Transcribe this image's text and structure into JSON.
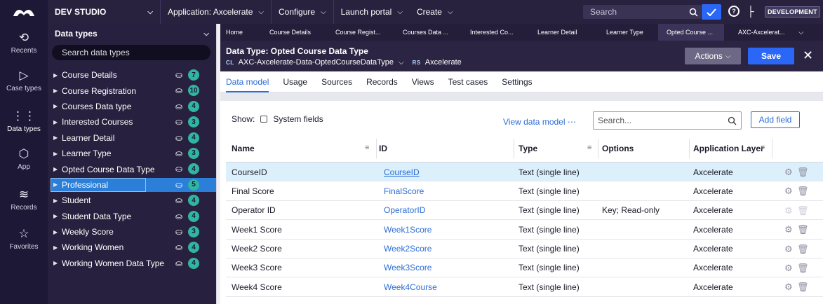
{
  "topbar": {
    "studio": "DEV STUDIO",
    "application": "Application: Axcelerate",
    "configure": "Configure",
    "launch": "Launch portal",
    "create": "Create",
    "search_placeholder": "Search",
    "dev_badge": "DEVELOPMENT"
  },
  "rail": [
    {
      "label": "Recents",
      "icon": "history-icon"
    },
    {
      "label": "Case types",
      "icon": "case-types-icon"
    },
    {
      "label": "Data types",
      "icon": "data-types-icon"
    },
    {
      "label": "App",
      "icon": "app-icon"
    },
    {
      "label": "Records",
      "icon": "records-icon"
    },
    {
      "label": "Favorites",
      "icon": "star-icon"
    }
  ],
  "panel": {
    "title": "Data types",
    "search_placeholder": "Search data types",
    "items": [
      {
        "name": "Course Details",
        "count": "7"
      },
      {
        "name": "Course Registration",
        "count": "10"
      },
      {
        "name": "Courses Data type",
        "count": "4"
      },
      {
        "name": "Interested Courses",
        "count": "3"
      },
      {
        "name": "Learner Detail",
        "count": "4"
      },
      {
        "name": "Learner Type",
        "count": "3"
      },
      {
        "name": "Opted Course Data Type",
        "count": "4"
      },
      {
        "name": "Professional",
        "count": "5"
      },
      {
        "name": "Student",
        "count": "4"
      },
      {
        "name": "Student Data Type",
        "count": "4"
      },
      {
        "name": "Weekly Score",
        "count": "3"
      },
      {
        "name": "Working Women",
        "count": "4"
      },
      {
        "name": "Working Women Data Type",
        "count": "4"
      }
    ]
  },
  "doc_tabs": [
    "Home",
    "Course Details",
    "Course Regist...",
    "Courses Data ...",
    "Interested Co...",
    "Learner Detail",
    "Learner Type",
    "Opted Course ...",
    "AXC-Axcelerat..."
  ],
  "header": {
    "title": "Data Type:  Opted Course Data Type",
    "cl_tag": "CL",
    "class_name": "AXC-Axcelerate-Data-OptedCourseDataType",
    "rs_tag": "RS",
    "ruleset": "Axcelerate",
    "actions": "Actions",
    "save": "Save"
  },
  "inner_tabs": [
    "Data model",
    "Usage",
    "Sources",
    "Records",
    "Views",
    "Test cases",
    "Settings"
  ],
  "toolbar": {
    "show_label": "Show:",
    "system_fields": "System fields",
    "view_data_model": "View data model",
    "search_placeholder": "Search...",
    "add_field": "Add field"
  },
  "table": {
    "columns": [
      "Name",
      "ID",
      "Type",
      "Options",
      "Application Layer"
    ],
    "rows": [
      {
        "name": "CourseID",
        "id": "CourseID",
        "type": "Text (single line)",
        "options": "",
        "layer": "Axcelerate"
      },
      {
        "name": "Final Score",
        "id": "FinalScore",
        "type": "Text (single line)",
        "options": "",
        "layer": "Axcelerate"
      },
      {
        "name": "Operator ID",
        "id": "OperatorID",
        "type": "Text (single line)",
        "options": "Key; Read-only",
        "layer": "Axcelerate"
      },
      {
        "name": "Week1 Score",
        "id": "Week1Score",
        "type": "Text (single line)",
        "options": "",
        "layer": "Axcelerate"
      },
      {
        "name": "Week2 Score",
        "id": "Week2Score",
        "type": "Text (single line)",
        "options": "",
        "layer": "Axcelerate"
      },
      {
        "name": "Week3 Score",
        "id": "Week3Score",
        "type": "Text (single line)",
        "options": "",
        "layer": "Axcelerate"
      },
      {
        "name": "Week4 Score",
        "id": "Week4Course",
        "type": "Text (single line)",
        "options": "",
        "layer": "Axcelerate"
      }
    ]
  },
  "colors": {
    "accent": "#2b67f6",
    "link": "#2b6dd6",
    "count_badge": "#2fb5a0",
    "selected": "#2b7fd8",
    "row_highlight": "#dcf0fc"
  }
}
